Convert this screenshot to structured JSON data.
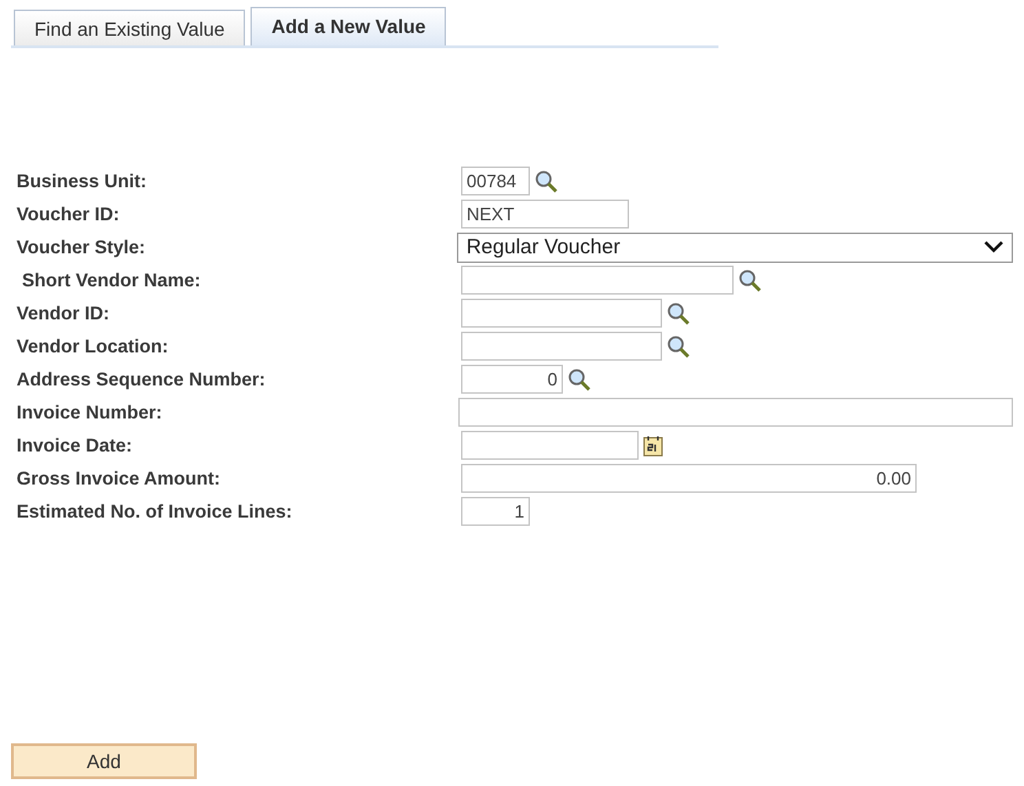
{
  "tabs": [
    {
      "label": "Find an Existing Value",
      "selected": false
    },
    {
      "label": "Add a New Value",
      "selected": true
    }
  ],
  "fields": [
    {
      "label": "Business Unit:",
      "kind": "lookup",
      "value": "00784",
      "numeric": false
    },
    {
      "label": "Voucher ID:",
      "kind": "text",
      "value": "NEXT",
      "numeric": false
    },
    {
      "label": "Voucher Style:",
      "kind": "select",
      "value": "Regular Voucher"
    },
    {
      "label": "Short Vendor Name:",
      "kind": "lookup"
    },
    {
      "label": "Vendor ID:",
      "kind": "lookup"
    },
    {
      "label": "Vendor Location:",
      "kind": "lookup"
    },
    {
      "label": "Address Sequence Number:",
      "kind": "lookup",
      "value": "0",
      "numeric": true
    },
    {
      "label": "Invoice Number:",
      "kind": "text"
    },
    {
      "label": "Invoice Date:",
      "kind": "date"
    },
    {
      "label": "Gross Invoice Amount:",
      "kind": "text",
      "value": "0.00",
      "numeric": true
    },
    {
      "label": "Estimated No. of Invoice Lines:",
      "kind": "text",
      "value": "1",
      "numeric": true
    }
  ],
  "button": "Add"
}
